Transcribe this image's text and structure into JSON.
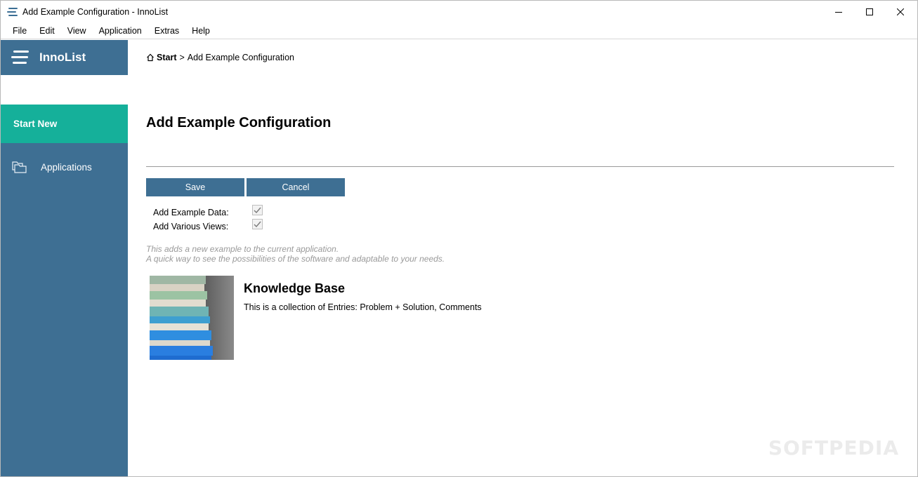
{
  "window": {
    "title": "Add Example Configuration - InnoList"
  },
  "menu": {
    "items": [
      "File",
      "Edit",
      "View",
      "Application",
      "Extras",
      "Help"
    ]
  },
  "sidebar": {
    "brand": "InnoList",
    "items": [
      {
        "label": "Start New",
        "active": true
      },
      {
        "label": "Applications",
        "icon": "folders-icon"
      }
    ]
  },
  "breadcrumb": {
    "home": "Start",
    "separator": ">",
    "current": "Add Example Configuration"
  },
  "page": {
    "title": "Add Example Configuration",
    "save_label": "Save",
    "cancel_label": "Cancel",
    "options": [
      {
        "label": "Add Example Data:",
        "checked": true
      },
      {
        "label": "Add Various Views:",
        "checked": true
      }
    ],
    "hint_lines": [
      "This adds a new example to the current application.",
      "A quick way to see the possibilities of the software and adaptable to your needs."
    ],
    "example": {
      "title": "Knowledge Base",
      "description": "This is a collection of Entries: Problem + Solution, Comments"
    }
  },
  "watermark": "SOFTPEDIA",
  "colors": {
    "sidebar": "#3e6f93",
    "active": "#15b09a",
    "button": "#3e6f93"
  }
}
